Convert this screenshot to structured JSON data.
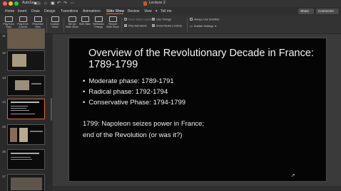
{
  "titlebar": {
    "autosave_label": "AutoSave",
    "autosave_state": "off",
    "document_title": "Lecture 2",
    "icons": [
      "home-icon",
      "save-icon",
      "undo-icon",
      "redo-icon",
      "more-icon"
    ]
  },
  "ribbon_tabs": {
    "items": [
      "Home",
      "Insert",
      "Draw",
      "Design",
      "Transitions",
      "Animations",
      "Slide Show",
      "Review",
      "View"
    ],
    "active": "Slide Show",
    "tell_me": "Tell me",
    "share_label": "Share",
    "comments_label": "Comments",
    "accent_color": "#e06b3a"
  },
  "ribbon_toolbar": {
    "buttons": [
      {
        "label": "Play from Start",
        "icon": "play-from-start-icon"
      },
      {
        "label": "Play from Current Slide",
        "icon": "play-current-icon"
      },
      {
        "label": "Presenter View",
        "icon": "presenter-view-icon"
      },
      {
        "label": "Custom Show",
        "icon": "custom-show-icon"
      },
      {
        "label": "Set Up Slide Show",
        "icon": "setup-show-icon"
      },
      {
        "label": "Hide Slide",
        "icon": "hide-slide-icon"
      },
      {
        "label": "Rehearse Timings",
        "icon": "rehearse-icon"
      },
      {
        "label": "Record Slide Show",
        "icon": "record-icon"
      }
    ],
    "checkboxes": [
      {
        "label": "Keep Slides Updated",
        "checked": false
      },
      {
        "label": "Use Timings",
        "checked": true
      },
      {
        "label": "Play Narrations",
        "checked": true
      },
      {
        "label": "Show Media Controls",
        "checked": true
      },
      {
        "label": "Always Use Subtitles",
        "checked": false
      }
    ],
    "subtitle_settings": "Subtitle Settings"
  },
  "thumbnails": {
    "numbers": [
      "11",
      "12",
      "13",
      "14",
      "15",
      "16",
      "17"
    ],
    "selected": "14"
  },
  "slide": {
    "title": "Overview of the Revolutionary Decade in France: 1789-1799",
    "bullets": [
      "Moderate phase: 1789-1791",
      "Radical phase: 1792-1794",
      "Conservative Phase: 1794-1799"
    ],
    "note_line1": "1799: Napoleon seizes power in France;",
    "note_line2": "end of the Revolution (or was it?)",
    "background": "#050505"
  }
}
